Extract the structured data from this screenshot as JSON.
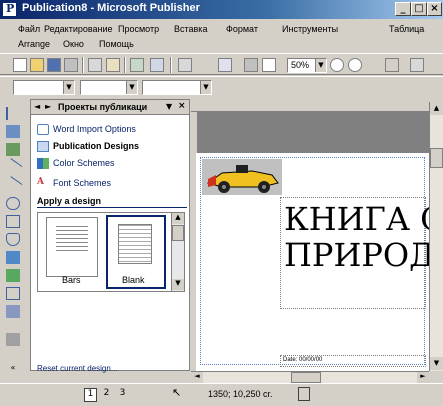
{
  "window": {
    "title": "Publication8 - Microsoft Publisher"
  },
  "menu": {
    "row1": [
      "Файл",
      "Редактирование",
      "Просмотр",
      "Вставка",
      "Формат",
      "Инструменты",
      "Таблица"
    ],
    "row2": [
      "Arrange",
      "Окно",
      "Помощь"
    ]
  },
  "toolbar": {
    "zoom_value": "50%"
  },
  "taskpane": {
    "title": "Проекты публикаци",
    "links": [
      "Word Import Options",
      "Publication Designs",
      "Color Schemes",
      "Font Schemes"
    ],
    "apply_heading": "Apply a design",
    "designs": [
      "Bars",
      "Blank"
    ],
    "footer_link": "Reset current design..."
  },
  "document": {
    "title_line1": "КНИГА О",
    "title_line2": "ПРИРОДЕ",
    "date_text": "Date: 00/00/00"
  },
  "statusbar": {
    "pages": [
      "1",
      "2",
      "3"
    ],
    "coordinates": "1350; 10,250 cr."
  },
  "colors": {
    "titlebar": "#0a246a",
    "chrome": "#d4d0c8",
    "workspace": "#808080",
    "selection": "#0a246a"
  }
}
